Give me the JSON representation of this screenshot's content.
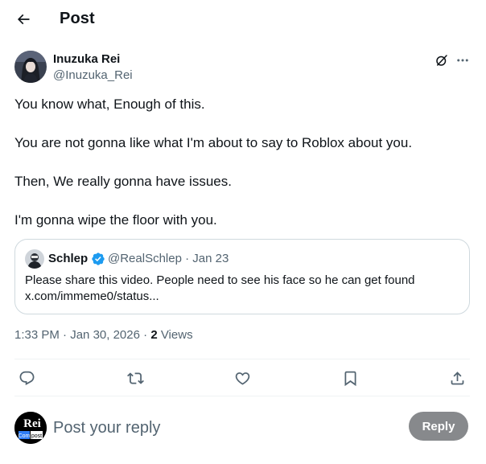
{
  "header": {
    "title": "Post",
    "back_icon": "back-arrow-icon"
  },
  "post": {
    "author": {
      "display_name": "Inuzuka Rei",
      "handle": "@Inuzuka_Rei"
    },
    "paragraphs": [
      "You know what, Enough of this.",
      "You are not gonna like what I'm about to say to Roblox about you.",
      "Then, We really gonna have issues.",
      "I'm gonna wipe the floor with you."
    ],
    "quote": {
      "display_name": "Schlep",
      "handle": "@RealSchlep",
      "date": "Jan 23",
      "text": "Please share this video. People need to see his face so he can get found",
      "link": "x.com/immeme0/status..."
    },
    "time": "1:33 PM",
    "date": "Jan 30, 2026",
    "views_count": "2",
    "views_label": "Views"
  },
  "reply": {
    "placeholder": "Post your reply",
    "button_label": "Reply",
    "avatar_text_top": "Rei",
    "avatar_text_left": "Com",
    "avatar_text_right": "post"
  },
  "colors": {
    "text": "#0f1419",
    "secondary": "#536471",
    "border": "#cfd9de",
    "verified": "#1d9bf0",
    "reply_button_disabled": "#87898c"
  }
}
